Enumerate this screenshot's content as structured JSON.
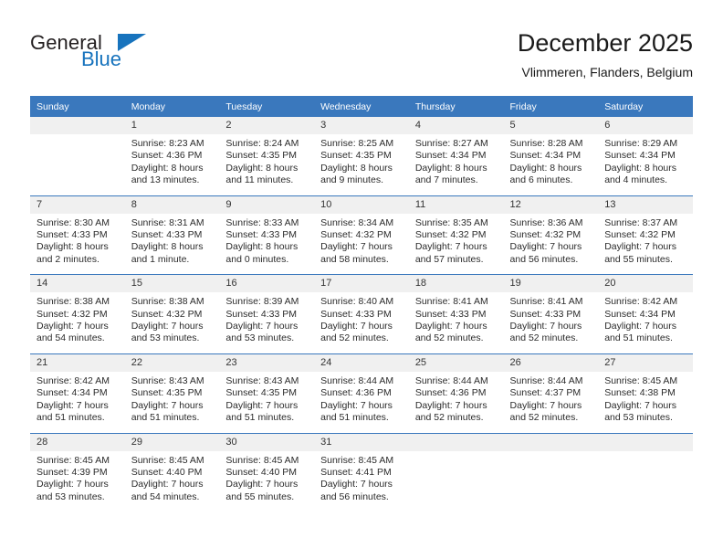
{
  "brand": {
    "name_top": "General",
    "name_bottom": "Blue",
    "triangle_icon": "triangle-icon",
    "color_dark": "#231f20",
    "color_blue": "#1773bd"
  },
  "header": {
    "title": "December 2025",
    "subtitle": "Vlimmeren, Flanders, Belgium"
  },
  "calendar": {
    "header_bg": "#3a78bd",
    "band_bg": "#f0f0f0",
    "weekdays": [
      "Sunday",
      "Monday",
      "Tuesday",
      "Wednesday",
      "Thursday",
      "Friday",
      "Saturday"
    ],
    "weeks": [
      [
        {
          "day": "",
          "sunrise": "",
          "sunset": "",
          "daylight1": "",
          "daylight2": ""
        },
        {
          "day": "1",
          "sunrise": "Sunrise: 8:23 AM",
          "sunset": "Sunset: 4:36 PM",
          "daylight1": "Daylight: 8 hours",
          "daylight2": "and 13 minutes."
        },
        {
          "day": "2",
          "sunrise": "Sunrise: 8:24 AM",
          "sunset": "Sunset: 4:35 PM",
          "daylight1": "Daylight: 8 hours",
          "daylight2": "and 11 minutes."
        },
        {
          "day": "3",
          "sunrise": "Sunrise: 8:25 AM",
          "sunset": "Sunset: 4:35 PM",
          "daylight1": "Daylight: 8 hours",
          "daylight2": "and 9 minutes."
        },
        {
          "day": "4",
          "sunrise": "Sunrise: 8:27 AM",
          "sunset": "Sunset: 4:34 PM",
          "daylight1": "Daylight: 8 hours",
          "daylight2": "and 7 minutes."
        },
        {
          "day": "5",
          "sunrise": "Sunrise: 8:28 AM",
          "sunset": "Sunset: 4:34 PM",
          "daylight1": "Daylight: 8 hours",
          "daylight2": "and 6 minutes."
        },
        {
          "day": "6",
          "sunrise": "Sunrise: 8:29 AM",
          "sunset": "Sunset: 4:34 PM",
          "daylight1": "Daylight: 8 hours",
          "daylight2": "and 4 minutes."
        }
      ],
      [
        {
          "day": "7",
          "sunrise": "Sunrise: 8:30 AM",
          "sunset": "Sunset: 4:33 PM",
          "daylight1": "Daylight: 8 hours",
          "daylight2": "and 2 minutes."
        },
        {
          "day": "8",
          "sunrise": "Sunrise: 8:31 AM",
          "sunset": "Sunset: 4:33 PM",
          "daylight1": "Daylight: 8 hours",
          "daylight2": "and 1 minute."
        },
        {
          "day": "9",
          "sunrise": "Sunrise: 8:33 AM",
          "sunset": "Sunset: 4:33 PM",
          "daylight1": "Daylight: 8 hours",
          "daylight2": "and 0 minutes."
        },
        {
          "day": "10",
          "sunrise": "Sunrise: 8:34 AM",
          "sunset": "Sunset: 4:32 PM",
          "daylight1": "Daylight: 7 hours",
          "daylight2": "and 58 minutes."
        },
        {
          "day": "11",
          "sunrise": "Sunrise: 8:35 AM",
          "sunset": "Sunset: 4:32 PM",
          "daylight1": "Daylight: 7 hours",
          "daylight2": "and 57 minutes."
        },
        {
          "day": "12",
          "sunrise": "Sunrise: 8:36 AM",
          "sunset": "Sunset: 4:32 PM",
          "daylight1": "Daylight: 7 hours",
          "daylight2": "and 56 minutes."
        },
        {
          "day": "13",
          "sunrise": "Sunrise: 8:37 AM",
          "sunset": "Sunset: 4:32 PM",
          "daylight1": "Daylight: 7 hours",
          "daylight2": "and 55 minutes."
        }
      ],
      [
        {
          "day": "14",
          "sunrise": "Sunrise: 8:38 AM",
          "sunset": "Sunset: 4:32 PM",
          "daylight1": "Daylight: 7 hours",
          "daylight2": "and 54 minutes."
        },
        {
          "day": "15",
          "sunrise": "Sunrise: 8:38 AM",
          "sunset": "Sunset: 4:32 PM",
          "daylight1": "Daylight: 7 hours",
          "daylight2": "and 53 minutes."
        },
        {
          "day": "16",
          "sunrise": "Sunrise: 8:39 AM",
          "sunset": "Sunset: 4:33 PM",
          "daylight1": "Daylight: 7 hours",
          "daylight2": "and 53 minutes."
        },
        {
          "day": "17",
          "sunrise": "Sunrise: 8:40 AM",
          "sunset": "Sunset: 4:33 PM",
          "daylight1": "Daylight: 7 hours",
          "daylight2": "and 52 minutes."
        },
        {
          "day": "18",
          "sunrise": "Sunrise: 8:41 AM",
          "sunset": "Sunset: 4:33 PM",
          "daylight1": "Daylight: 7 hours",
          "daylight2": "and 52 minutes."
        },
        {
          "day": "19",
          "sunrise": "Sunrise: 8:41 AM",
          "sunset": "Sunset: 4:33 PM",
          "daylight1": "Daylight: 7 hours",
          "daylight2": "and 52 minutes."
        },
        {
          "day": "20",
          "sunrise": "Sunrise: 8:42 AM",
          "sunset": "Sunset: 4:34 PM",
          "daylight1": "Daylight: 7 hours",
          "daylight2": "and 51 minutes."
        }
      ],
      [
        {
          "day": "21",
          "sunrise": "Sunrise: 8:42 AM",
          "sunset": "Sunset: 4:34 PM",
          "daylight1": "Daylight: 7 hours",
          "daylight2": "and 51 minutes."
        },
        {
          "day": "22",
          "sunrise": "Sunrise: 8:43 AM",
          "sunset": "Sunset: 4:35 PM",
          "daylight1": "Daylight: 7 hours",
          "daylight2": "and 51 minutes."
        },
        {
          "day": "23",
          "sunrise": "Sunrise: 8:43 AM",
          "sunset": "Sunset: 4:35 PM",
          "daylight1": "Daylight: 7 hours",
          "daylight2": "and 51 minutes."
        },
        {
          "day": "24",
          "sunrise": "Sunrise: 8:44 AM",
          "sunset": "Sunset: 4:36 PM",
          "daylight1": "Daylight: 7 hours",
          "daylight2": "and 51 minutes."
        },
        {
          "day": "25",
          "sunrise": "Sunrise: 8:44 AM",
          "sunset": "Sunset: 4:36 PM",
          "daylight1": "Daylight: 7 hours",
          "daylight2": "and 52 minutes."
        },
        {
          "day": "26",
          "sunrise": "Sunrise: 8:44 AM",
          "sunset": "Sunset: 4:37 PM",
          "daylight1": "Daylight: 7 hours",
          "daylight2": "and 52 minutes."
        },
        {
          "day": "27",
          "sunrise": "Sunrise: 8:45 AM",
          "sunset": "Sunset: 4:38 PM",
          "daylight1": "Daylight: 7 hours",
          "daylight2": "and 53 minutes."
        }
      ],
      [
        {
          "day": "28",
          "sunrise": "Sunrise: 8:45 AM",
          "sunset": "Sunset: 4:39 PM",
          "daylight1": "Daylight: 7 hours",
          "daylight2": "and 53 minutes."
        },
        {
          "day": "29",
          "sunrise": "Sunrise: 8:45 AM",
          "sunset": "Sunset: 4:40 PM",
          "daylight1": "Daylight: 7 hours",
          "daylight2": "and 54 minutes."
        },
        {
          "day": "30",
          "sunrise": "Sunrise: 8:45 AM",
          "sunset": "Sunset: 4:40 PM",
          "daylight1": "Daylight: 7 hours",
          "daylight2": "and 55 minutes."
        },
        {
          "day": "31",
          "sunrise": "Sunrise: 8:45 AM",
          "sunset": "Sunset: 4:41 PM",
          "daylight1": "Daylight: 7 hours",
          "daylight2": "and 56 minutes."
        },
        {
          "day": "",
          "sunrise": "",
          "sunset": "",
          "daylight1": "",
          "daylight2": ""
        },
        {
          "day": "",
          "sunrise": "",
          "sunset": "",
          "daylight1": "",
          "daylight2": ""
        },
        {
          "day": "",
          "sunrise": "",
          "sunset": "",
          "daylight1": "",
          "daylight2": ""
        }
      ]
    ]
  }
}
